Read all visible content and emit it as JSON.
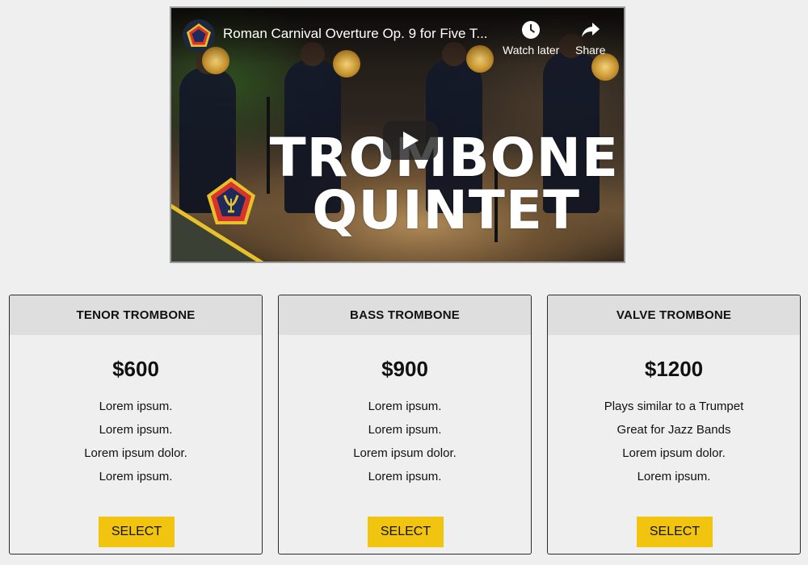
{
  "video": {
    "title": "Roman Carnival Overture Op. 9 for Five T...",
    "watch_later_label": "Watch later",
    "share_label": "Share",
    "thumbnail_line1": "TROMBONE",
    "thumbnail_line2": "QUINTET",
    "icons": {
      "channel": "channel-avatar-icon",
      "watch_later": "clock-icon",
      "share": "share-arrow-icon",
      "play": "play-icon",
      "badge": "lyre-badge-icon"
    }
  },
  "colors": {
    "accent": "#f1c40f",
    "card_header_bg": "#dedede",
    "page_bg": "#efefef",
    "banner_green": "#3a4034",
    "banner_stripe": "#e7c12b"
  },
  "cards": [
    {
      "title": "TENOR TROMBONE",
      "price": "$600",
      "features": [
        "Lorem ipsum.",
        "Lorem ipsum.",
        "Lorem ipsum dolor.",
        "Lorem ipsum."
      ],
      "button_label": "SELECT"
    },
    {
      "title": "BASS TROMBONE",
      "price": "$900",
      "features": [
        "Lorem ipsum.",
        "Lorem ipsum.",
        "Lorem ipsum dolor.",
        "Lorem ipsum."
      ],
      "button_label": "SELECT"
    },
    {
      "title": "VALVE TROMBONE",
      "price": "$1200",
      "features": [
        "Plays similar to a Trumpet",
        "Great for Jazz Bands",
        "Lorem ipsum dolor.",
        "Lorem ipsum."
      ],
      "button_label": "SELECT"
    }
  ]
}
